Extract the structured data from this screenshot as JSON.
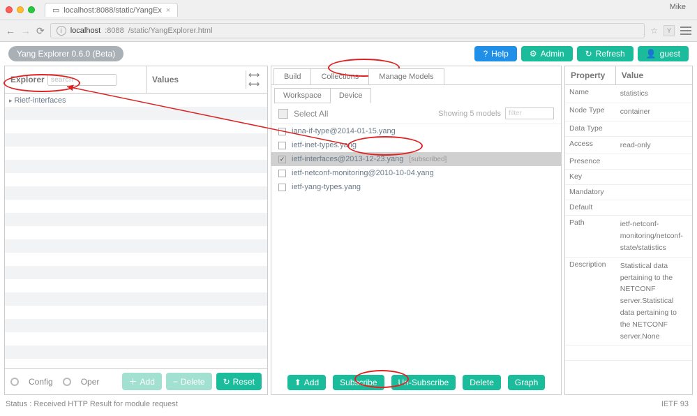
{
  "browser": {
    "tab_title": "localhost:8088/static/YangEx",
    "user": "Mike",
    "url_host": "localhost",
    "url_port": ":8088",
    "url_path": "/static/YangExplorer.html"
  },
  "app": {
    "version_label": "Yang Explorer 0.6.0 (Beta)",
    "buttons": {
      "help": "Help",
      "admin": "Admin",
      "refresh": "Refresh",
      "guest": "guest"
    }
  },
  "explorer": {
    "header_explorer": "Explorer",
    "header_values": "Values",
    "search_placeholder": "search",
    "tree_root": "Rietf-interfaces",
    "radio_config": "Config",
    "radio_oper": "Oper",
    "btn_add": "Add",
    "btn_delete": "Delete",
    "btn_reset": "Reset"
  },
  "center": {
    "tabs": {
      "build": "Build",
      "collections": "Collections",
      "manage": "Manage Models"
    },
    "subtabs": {
      "workspace": "Workspace",
      "device": "Device"
    },
    "select_all": "Select All",
    "showing": "Showing 5 models",
    "filter_placeholder": "filter",
    "models": [
      {
        "name": "iana-if-type@2014-01-15.yang",
        "checked": false
      },
      {
        "name": "ietf-inet-types.yang",
        "checked": false
      },
      {
        "name": "ietf-interfaces@2013-12-23.yang",
        "checked": true,
        "tag": "[subscribed]"
      },
      {
        "name": "ietf-netconf-monitoring@2010-10-04.yang",
        "checked": false
      },
      {
        "name": "ietf-yang-types.yang",
        "checked": false
      }
    ],
    "btns": {
      "add": "Add",
      "subscribe": "Subscribe",
      "unsubscribe": "Un-Subscribe",
      "delete": "Delete",
      "graph": "Graph"
    }
  },
  "props": {
    "header_property": "Property",
    "header_value": "Value",
    "rows": {
      "name_k": "Name",
      "name_v": "statistics",
      "nodetype_k": "Node Type",
      "nodetype_v": "container",
      "datatype_k": "Data Type",
      "datatype_v": "",
      "access_k": "Access",
      "access_v": "read-only",
      "presence_k": "Presence",
      "presence_v": "",
      "key_k": "Key",
      "key_v": "",
      "mandatory_k": "Mandatory",
      "mandatory_v": "",
      "default_k": "Default",
      "default_v": "",
      "path_k": "Path",
      "path_v": "ietf-netconf-monitoring/netconf-state/statistics",
      "desc_k": "Description",
      "desc_v": "Statistical data pertaining to the NETCONF server.Statistical data pertaining to the NETCONF server.None"
    }
  },
  "status": {
    "text": "Status : Received HTTP Result for module request",
    "right": "IETF 93"
  }
}
